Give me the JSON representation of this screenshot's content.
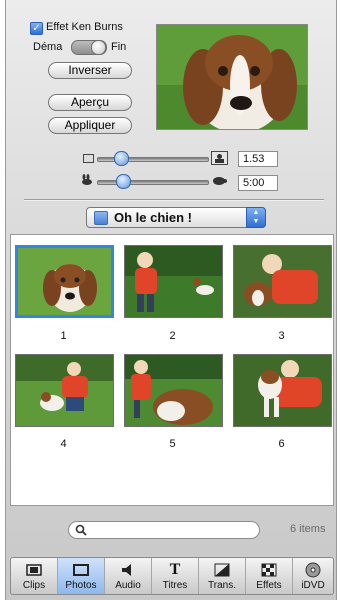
{
  "ken_burns": {
    "checkbox_label": "Effet Ken Burns",
    "start_label": "Déma",
    "end_label": "Fin",
    "reverse_button": "Inverser",
    "preview_button": "Aperçu",
    "apply_button": "Appliquer",
    "zoom_value": "1.53",
    "zoom_level_fraction": 0.18,
    "duration_value": "5:00",
    "duration_level_fraction": 0.2
  },
  "album": {
    "selected": "Oh le chien !"
  },
  "photos": [
    {
      "caption": "1",
      "selected": true
    },
    {
      "caption": "2",
      "selected": false
    },
    {
      "caption": "3",
      "selected": false
    },
    {
      "caption": "4",
      "selected": false
    },
    {
      "caption": "5",
      "selected": false
    },
    {
      "caption": "6",
      "selected": false
    }
  ],
  "footer": {
    "search_placeholder": "",
    "item_count": "6 items"
  },
  "toolbar": {
    "tabs": [
      "Clips",
      "Photos",
      "Audio",
      "Titres",
      "Trans.",
      "Effets",
      "iDVD"
    ],
    "active": "Photos"
  },
  "colors": {
    "accent": "#2f86e6",
    "panel": "#d6d6d6"
  },
  "icons": [
    "checkmark-icon",
    "small-photo-icon",
    "large-photo-icon",
    "rabbit-icon",
    "turtle-icon",
    "album-icon",
    "magnifier-icon",
    "clips-icon",
    "photos-icon",
    "audio-icon",
    "titles-icon",
    "transitions-icon",
    "effects-icon",
    "idvd-icon"
  ]
}
